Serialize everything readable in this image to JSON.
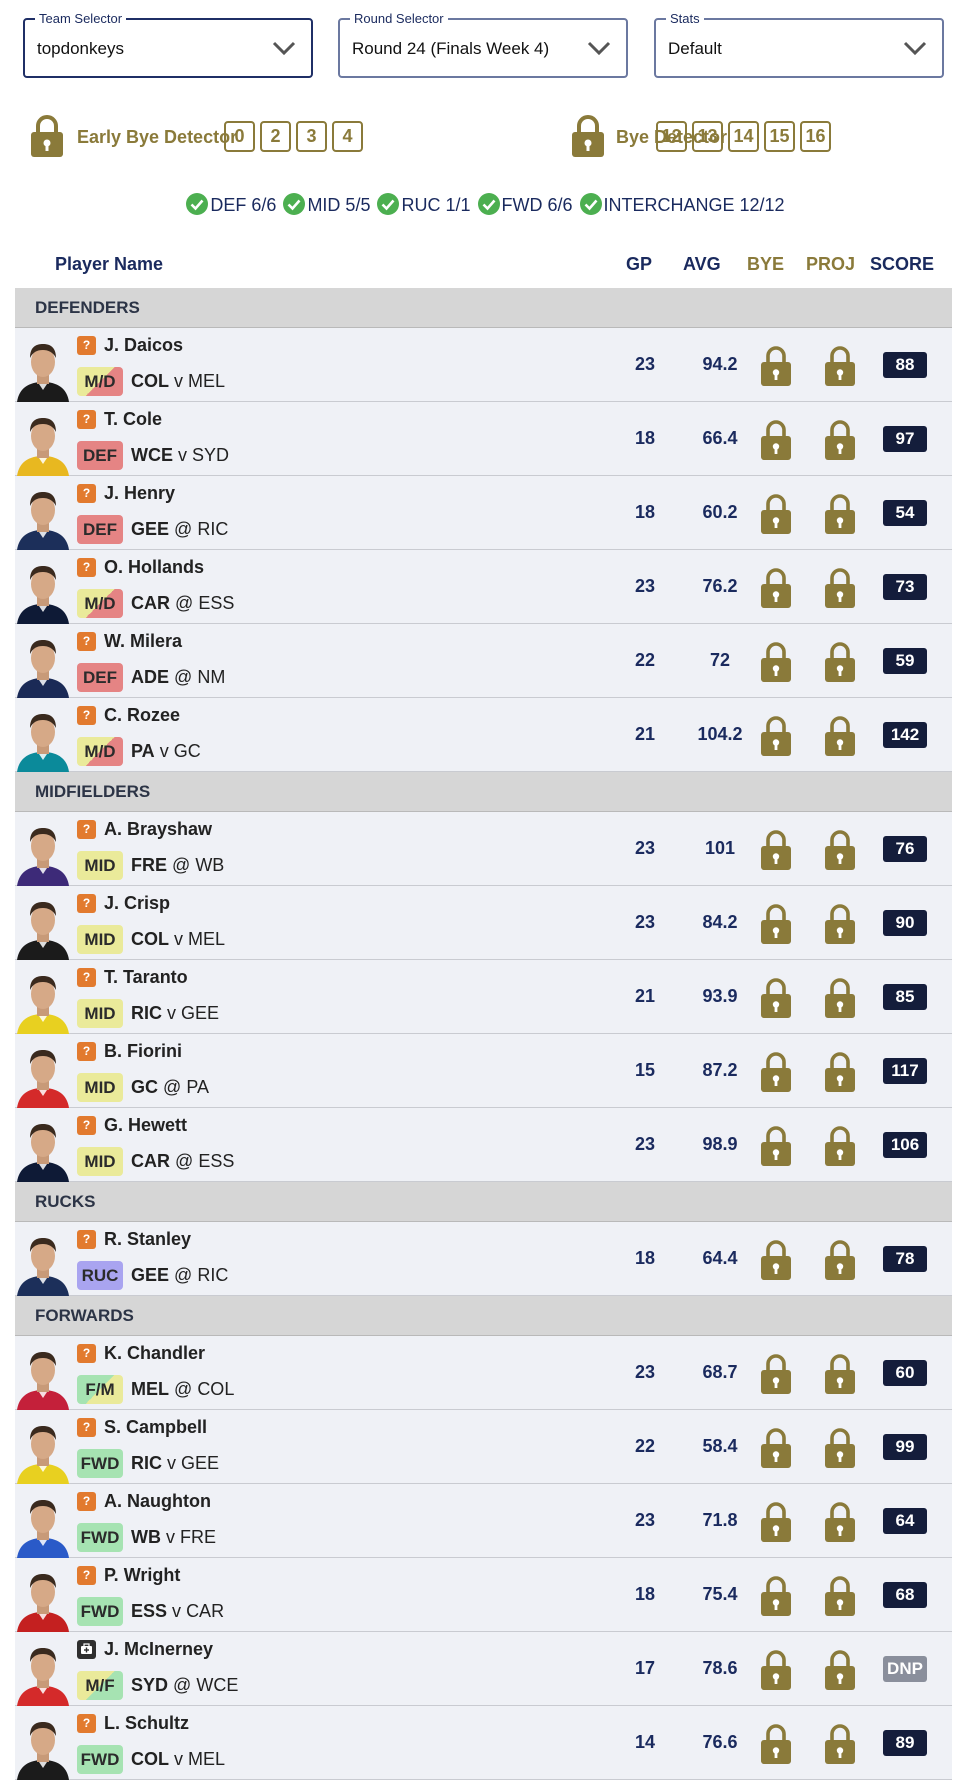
{
  "selectors": {
    "team": {
      "legend": "Team Selector",
      "value": "topdonkeys"
    },
    "round": {
      "legend": "Round Selector",
      "value": "Round 24 (Finals Week 4)"
    },
    "stats": {
      "legend": "Stats",
      "value": "Default"
    }
  },
  "early_bye": {
    "label": "Early Bye Detector",
    "rounds": [
      "0",
      "2",
      "3",
      "4"
    ]
  },
  "bye": {
    "label": "Bye Detector",
    "rounds": [
      "12",
      "13",
      "14",
      "15",
      "16"
    ]
  },
  "position_counts": [
    "DEF 6/6",
    "MID 5/5",
    "RUC 1/1",
    "FWD 6/6",
    "INTERCHANGE 12/12"
  ],
  "table_headers": {
    "name": "Player Name",
    "gp": "GP",
    "avg": "AVG",
    "bye": "BYE",
    "proj": "PROJ",
    "score": "SCORE"
  },
  "sections": [
    {
      "title": "DEFENDERS",
      "players": [
        {
          "name": "J. Daicos",
          "pos": "M/D",
          "pos_class": "MD",
          "team": "COL",
          "sep": "v",
          "opp": "MEL",
          "gp": "23",
          "avg": "94.2",
          "score": "88",
          "status": "?",
          "jersey": "#1b1b1b"
        },
        {
          "name": "T. Cole",
          "pos": "DEF",
          "pos_class": "DEF",
          "team": "WCE",
          "sep": "v",
          "opp": "SYD",
          "gp": "18",
          "avg": "66.4",
          "score": "97",
          "status": "?",
          "jersey": "#e8b820"
        },
        {
          "name": "J. Henry",
          "pos": "DEF",
          "pos_class": "DEF",
          "team": "GEE",
          "sep": "@",
          "opp": "RIC",
          "gp": "18",
          "avg": "60.2",
          "score": "54",
          "status": "?",
          "jersey": "#1c2f5a"
        },
        {
          "name": "O. Hollands",
          "pos": "M/D",
          "pos_class": "MD",
          "team": "CAR",
          "sep": "@",
          "opp": "ESS",
          "gp": "23",
          "avg": "76.2",
          "score": "73",
          "status": "?",
          "jersey": "#0e1a36"
        },
        {
          "name": "W. Milera",
          "pos": "DEF",
          "pos_class": "DEF",
          "team": "ADE",
          "sep": "@",
          "opp": "NM",
          "gp": "22",
          "avg": "72",
          "score": "59",
          "status": "?",
          "jersey": "#1a2a56"
        },
        {
          "name": "C. Rozee",
          "pos": "M/D",
          "pos_class": "MD",
          "team": "PA",
          "sep": "v",
          "opp": "GC",
          "gp": "21",
          "avg": "104.2",
          "score": "142",
          "status": "?",
          "jersey": "#0b8a9a"
        }
      ]
    },
    {
      "title": "MIDFIELDERS",
      "players": [
        {
          "name": "A. Brayshaw",
          "pos": "MID",
          "pos_class": "MID",
          "team": "FRE",
          "sep": "@",
          "opp": "WB",
          "gp": "23",
          "avg": "101",
          "score": "76",
          "status": "?",
          "jersey": "#3d2a78"
        },
        {
          "name": "J. Crisp",
          "pos": "MID",
          "pos_class": "MID",
          "team": "COL",
          "sep": "v",
          "opp": "MEL",
          "gp": "23",
          "avg": "84.2",
          "score": "90",
          "status": "?",
          "jersey": "#1b1b1b"
        },
        {
          "name": "T. Taranto",
          "pos": "MID",
          "pos_class": "MID",
          "team": "RIC",
          "sep": "v",
          "opp": "GEE",
          "gp": "21",
          "avg": "93.9",
          "score": "85",
          "status": "?",
          "jersey": "#e8d020"
        },
        {
          "name": "B. Fiorini",
          "pos": "MID",
          "pos_class": "MID",
          "team": "GC",
          "sep": "@",
          "opp": "PA",
          "gp": "15",
          "avg": "87.2",
          "score": "117",
          "status": "?",
          "jersey": "#d42a2a"
        },
        {
          "name": "G. Hewett",
          "pos": "MID",
          "pos_class": "MID",
          "team": "CAR",
          "sep": "@",
          "opp": "ESS",
          "gp": "23",
          "avg": "98.9",
          "score": "106",
          "status": "?",
          "jersey": "#0e1a36"
        }
      ]
    },
    {
      "title": "RUCKS",
      "players": [
        {
          "name": "R. Stanley",
          "pos": "RUC",
          "pos_class": "RUC",
          "team": "GEE",
          "sep": "@",
          "opp": "RIC",
          "gp": "18",
          "avg": "64.4",
          "score": "78",
          "status": "?",
          "jersey": "#1c2f5a"
        }
      ]
    },
    {
      "title": "FORWARDS",
      "players": [
        {
          "name": "K. Chandler",
          "pos": "F/M",
          "pos_class": "FM",
          "team": "MEL",
          "sep": "@",
          "opp": "COL",
          "gp": "23",
          "avg": "68.7",
          "score": "60",
          "status": "?",
          "jersey": "#c4203a"
        },
        {
          "name": "S. Campbell",
          "pos": "FWD",
          "pos_class": "FWD",
          "team": "RIC",
          "sep": "v",
          "opp": "GEE",
          "gp": "22",
          "avg": "58.4",
          "score": "99",
          "status": "?",
          "jersey": "#e8d020"
        },
        {
          "name": "A. Naughton",
          "pos": "FWD",
          "pos_class": "FWD",
          "team": "WB",
          "sep": "v",
          "opp": "FRE",
          "gp": "23",
          "avg": "71.8",
          "score": "64",
          "status": "?",
          "jersey": "#2a5ac8"
        },
        {
          "name": "P. Wright",
          "pos": "FWD",
          "pos_class": "FWD",
          "team": "ESS",
          "sep": "v",
          "opp": "CAR",
          "gp": "18",
          "avg": "75.4",
          "score": "68",
          "status": "?",
          "jersey": "#c42020"
        },
        {
          "name": "J. McInerney",
          "pos": "M/F",
          "pos_class": "MF",
          "team": "SYD",
          "sep": "@",
          "opp": "WCE",
          "gp": "17",
          "avg": "78.6",
          "score": "DNP",
          "status": "injury",
          "jersey": "#d42a2a"
        },
        {
          "name": "L. Schultz",
          "pos": "FWD",
          "pos_class": "FWD",
          "team": "COL",
          "sep": "v",
          "opp": "MEL",
          "gp": "14",
          "avg": "76.6",
          "score": "89",
          "status": "?",
          "jersey": "#1b1b1b"
        }
      ]
    }
  ],
  "colors": {
    "navy": "#1a2a5e",
    "gold": "#8a7a3a",
    "check": "#4caf50",
    "score_bg": "#141d3b",
    "section_bg": "#d6d6d6",
    "row_bg": "#eff1f6"
  }
}
